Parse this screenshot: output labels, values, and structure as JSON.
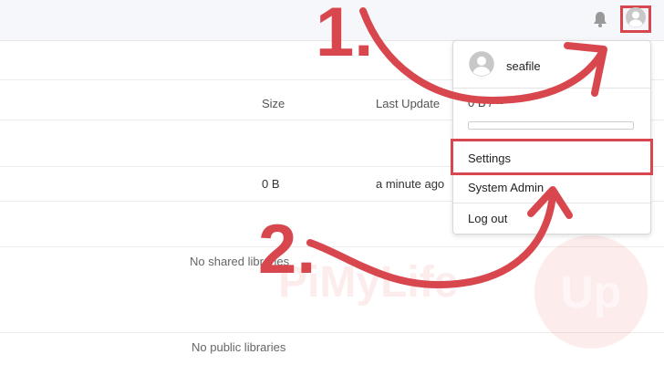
{
  "table": {
    "col_size": "Size",
    "col_last_update": "Last Update",
    "row_size": "0 B",
    "row_last_update": "a minute ago"
  },
  "empty": {
    "shared": "No shared libraries",
    "public": "No public libraries"
  },
  "header": {
    "notification_icon": "bell-icon",
    "avatar_icon": "user-avatar-icon"
  },
  "dropdown": {
    "username": "seafile",
    "quota_text": "0 B / --",
    "quota_used_fraction": 0,
    "items": [
      {
        "label": "Settings"
      },
      {
        "label": "System Admin"
      },
      {
        "label": "Log out"
      }
    ]
  },
  "annotations": {
    "step1": "1.",
    "step2": "2."
  },
  "watermark": {
    "text": "PiMyLife",
    "badge": "Up"
  },
  "colors": {
    "accent_red": "#d9474e",
    "topbar_bg": "#f6f7fa"
  }
}
